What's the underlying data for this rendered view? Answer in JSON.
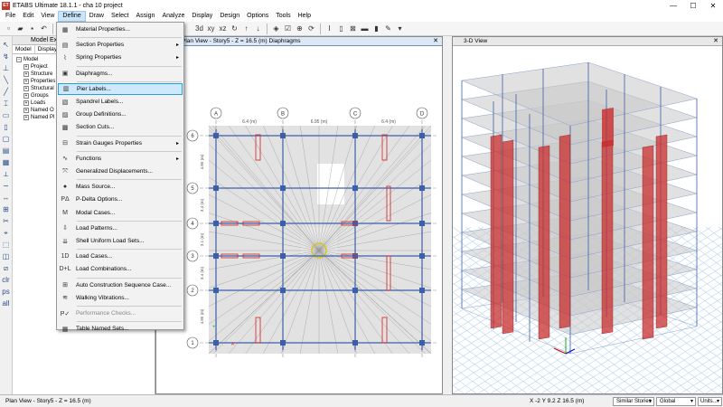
{
  "app": {
    "title": "ETABS Ultimate 18.1.1 - cha 10 project",
    "logo": "ET"
  },
  "menubar": [
    "File",
    "Edit",
    "View",
    "Define",
    "Draw",
    "Select",
    "Assign",
    "Analyze",
    "Display",
    "Design",
    "Options",
    "Tools",
    "Help"
  ],
  "explorer": {
    "title": "Model Exp",
    "tabs": [
      "Model",
      "Display"
    ],
    "tree": [
      "Model",
      "Project",
      "Structure",
      "Properties",
      "Structural",
      "Groups",
      "Loads",
      "Named O",
      "Named Pl"
    ]
  },
  "views": {
    "plan_title": "Plan View - Story5 - Z = 16.5 (m)  Diaphragms",
    "view3d_title": "3-D View"
  },
  "plan": {
    "col_labels": [
      "A",
      "B",
      "C",
      "D"
    ],
    "row_labels": [
      "6",
      "5",
      "4",
      "3",
      "2",
      "1"
    ],
    "spans": [
      "6.4 (m)",
      "6.95 (m)",
      "6.4 (m)"
    ],
    "row_dims": [
      "4.85 (m)",
      "3.4 (m)",
      "3.1 (m)",
      "3.4 (m)",
      "4.85 (m)"
    ]
  },
  "define_menu": {
    "items": [
      {
        "label": "Material Properties...",
        "icon": "material-icon",
        "glyph": "▦"
      },
      {
        "label": "Section Properties",
        "icon": "section-icon",
        "glyph": "▤",
        "submenu": true
      },
      {
        "label": "Spring Properties",
        "icon": "spring-icon",
        "glyph": "⌇",
        "submenu": true
      },
      {
        "label": "Diaphragms...",
        "icon": "diaphragm-icon",
        "glyph": "▣"
      },
      {
        "label": "Pier Labels...",
        "icon": "pier-icon",
        "glyph": "▥",
        "highlighted": true
      },
      {
        "label": "Spandrel Labels...",
        "icon": "spandrel-icon",
        "glyph": "▧"
      },
      {
        "label": "Group Definitions...",
        "icon": "group-icon",
        "glyph": "▨"
      },
      {
        "label": "Section Cuts...",
        "icon": "section-cut-icon",
        "glyph": "▩"
      },
      {
        "label": "Strain Gauges Properties",
        "icon": "strain-gauge-icon",
        "glyph": "⊟",
        "submenu": true
      },
      {
        "label": "Functions",
        "icon": "functions-icon",
        "glyph": "∿",
        "submenu": true
      },
      {
        "label": "Generalized Displacements...",
        "icon": "displacement-icon",
        "glyph": "⤧"
      },
      {
        "label": "Mass Source...",
        "icon": "mass-icon",
        "glyph": "●"
      },
      {
        "label": "P-Delta Options...",
        "icon": "pdelta-icon",
        "glyph": "PΔ"
      },
      {
        "label": "Modal Cases...",
        "icon": "modal-icon",
        "glyph": "M"
      },
      {
        "label": "Load Patterns...",
        "icon": "load-pattern-icon",
        "glyph": "⇩"
      },
      {
        "label": "Shell Uniform Load Sets...",
        "icon": "shell-load-icon",
        "glyph": "⇊"
      },
      {
        "label": "Load Cases...",
        "icon": "load-case-icon",
        "glyph": "1D"
      },
      {
        "label": "Load Combinations...",
        "icon": "load-combo-icon",
        "glyph": "D+L"
      },
      {
        "label": "Auto Construction Sequence Case...",
        "icon": "construction-icon",
        "glyph": "⊞"
      },
      {
        "label": "Walking Vibrations...",
        "icon": "walking-icon",
        "glyph": "≋"
      },
      {
        "label": "Performance Checks...",
        "icon": "performance-icon",
        "glyph": "P✓",
        "disabled": true
      },
      {
        "label": "Table Named Sets...",
        "icon": "table-icon",
        "glyph": "▦"
      }
    ]
  },
  "status": {
    "left": "Plan View - Story5 - Z = 16.5 (m)",
    "coords": "X -2  Y 9.2  Z 16.5 (m)",
    "stories": "Similar Stories",
    "coord_sys": "Global",
    "units": "Units..."
  }
}
